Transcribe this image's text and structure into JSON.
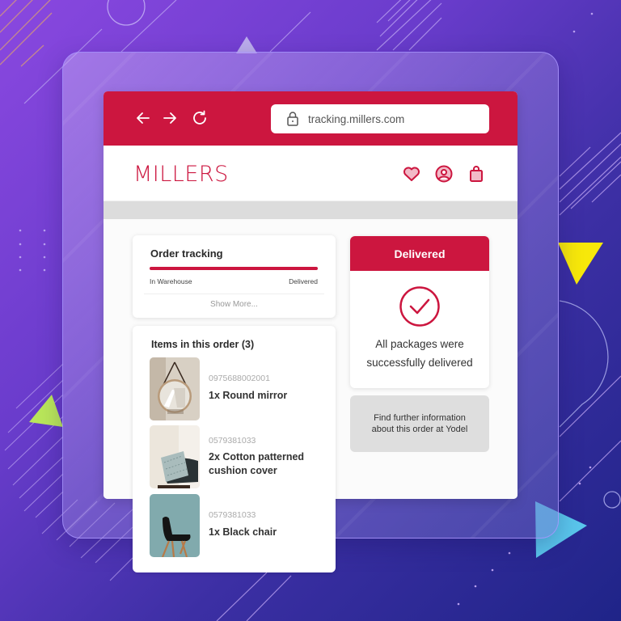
{
  "browser": {
    "url": "tracking.millers.com",
    "nav": {
      "back_icon": "arrow-left",
      "forward_icon": "arrow-right",
      "reload_icon": "reload"
    }
  },
  "site": {
    "logo": "MILLERS",
    "header_icons": [
      "heart-icon",
      "account-icon",
      "shopping-bag-icon"
    ],
    "brand_color": "#cc163f"
  },
  "tracking": {
    "title": "Order tracking",
    "progress_percent": 100,
    "start_label": "In Warehouse",
    "end_label": "Delivered",
    "show_more": "Show More..."
  },
  "items": {
    "title": "Items in this order (3)",
    "list": [
      {
        "sku": "0975688002001",
        "name": "1x Round mirror",
        "image": "round-mirror"
      },
      {
        "sku": "0579381033",
        "name": "2x Cotton patterned cushion cover",
        "image": "cushion-on-chair"
      },
      {
        "sku": "0579381033",
        "name": "1x Black chair",
        "image": "black-chair"
      }
    ]
  },
  "status": {
    "title": "Delivered",
    "icon": "check-circle",
    "message": "All packages were successfully delivered"
  },
  "yodel": {
    "label": "Find further information about this order at Yodel"
  }
}
